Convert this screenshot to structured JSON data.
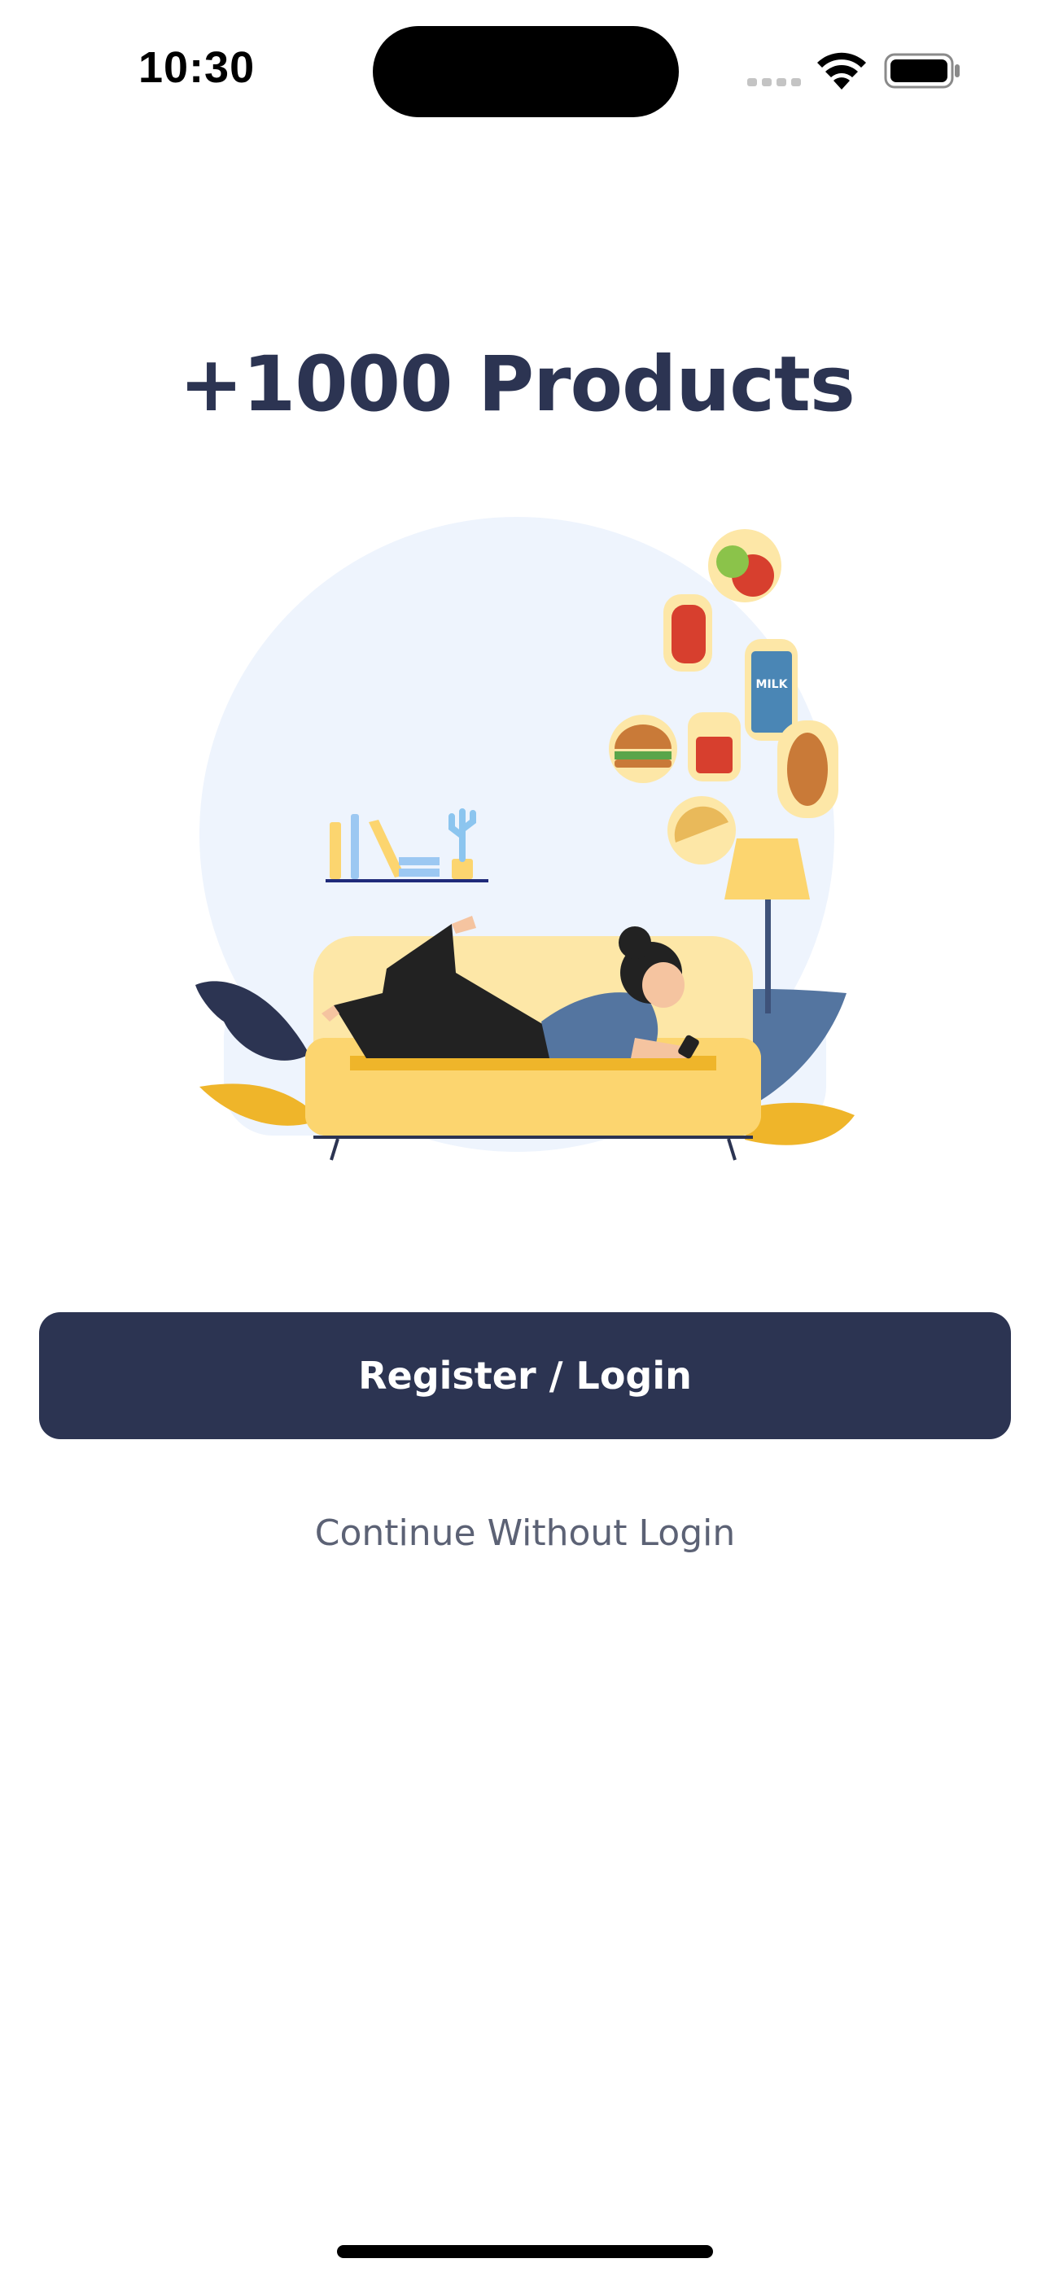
{
  "status_bar": {
    "time": "10:30"
  },
  "onboarding": {
    "headline": "+1000 Products",
    "illustration_label": "MILK"
  },
  "actions": {
    "primary_label": "Register / Login",
    "secondary_label": "Continue Without Login"
  },
  "colors": {
    "primary": "#2c3452",
    "circle_bg": "#eef4fd",
    "sofa": "#fcd56f",
    "accent_yellow": "#efb52a",
    "secondary_text": "#5c6275"
  },
  "icons": [
    "signal-icon",
    "wifi-icon",
    "battery-icon"
  ]
}
